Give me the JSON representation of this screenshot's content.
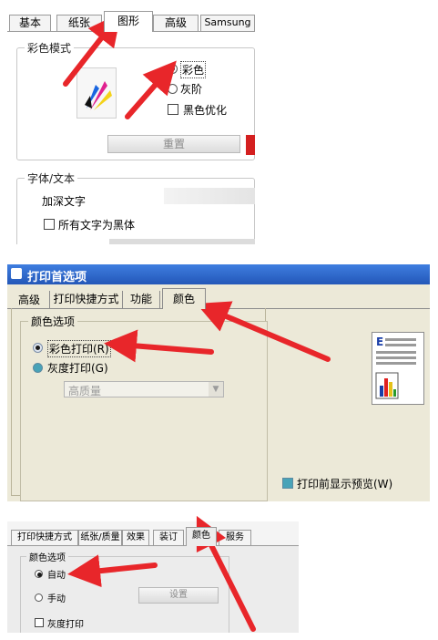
{
  "panel1": {
    "tabs": [
      "基本",
      "纸张",
      "图形",
      "高级",
      "Samsung"
    ],
    "color_mode": {
      "legend": "彩色模式",
      "options": [
        "彩色",
        "灰阶"
      ],
      "selected": "彩色",
      "checkbox_label": "黑色优化",
      "reset_button": "重置"
    },
    "font_text": {
      "legend": "字体/文本",
      "darken_label": "加深文字",
      "all_black_label": "所有文字为黑体"
    }
  },
  "panel2": {
    "title": "打印首选项",
    "tabs": [
      "高级",
      "打印快捷方式",
      "功能",
      "颜色"
    ],
    "group_legend": "颜色选项",
    "options": [
      "彩色打印(R)",
      "灰度打印(G)"
    ],
    "selected": "彩色打印(R)",
    "quality_select": "高质量",
    "preview_label": "打印前显示预览(W)",
    "colors": {
      "title_bar": "#2f66c9",
      "dialog_bg": "#ece9d8"
    }
  },
  "panel3": {
    "tabs": [
      "打印快捷方式",
      "纸张/质量",
      "效果",
      "装订",
      "颜色",
      "服务"
    ],
    "group_legend": "颜色选项",
    "options": [
      "自动",
      "手动"
    ],
    "selected": "自动",
    "settings_button": "设置",
    "grayscale_label": "灰度打印"
  },
  "annotation": {
    "arrow_color": "#e8262a"
  }
}
